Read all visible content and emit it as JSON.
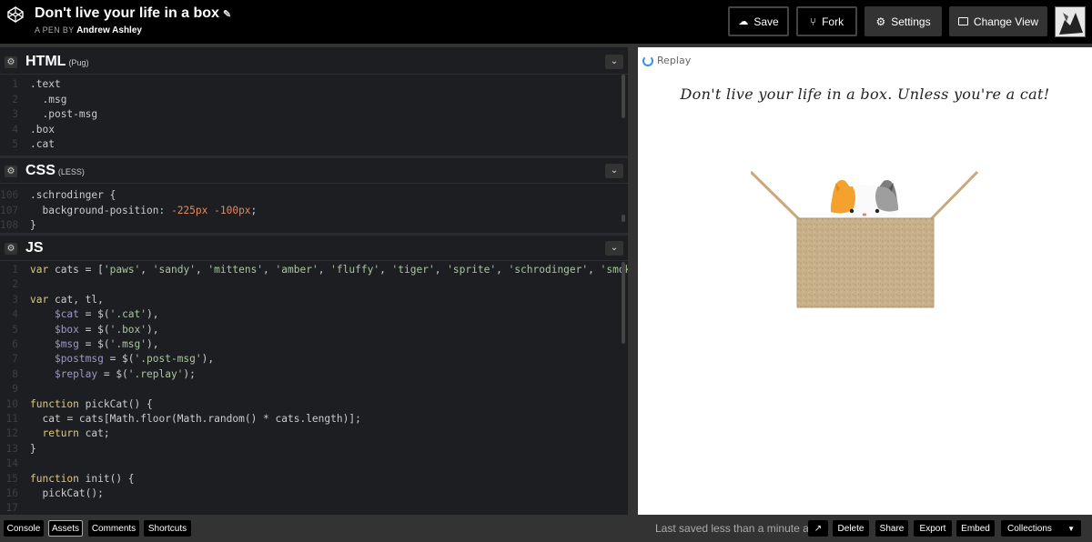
{
  "header": {
    "title": "Don't live your life in a box",
    "byline_prefix": "A PEN BY",
    "author": "Andrew Ashley",
    "buttons": {
      "save": "Save",
      "fork": "Fork",
      "settings": "Settings",
      "change_view": "Change View"
    }
  },
  "editors": {
    "html": {
      "label": "HTML",
      "sub": "(Pug)",
      "lines": [
        {
          "num": "1",
          "code": ".text"
        },
        {
          "num": "2",
          "code": "  .msg"
        },
        {
          "num": "3",
          "code": "  .post-msg"
        },
        {
          "num": "4",
          "code": ".box"
        },
        {
          "num": "5",
          "code": ".cat"
        }
      ]
    },
    "css": {
      "label": "CSS",
      "sub": "(LESS)",
      "lines": [
        {
          "num": "106",
          "code": ".schrodinger {"
        },
        {
          "num": "107",
          "code": "  background-position: -225px -100px;"
        },
        {
          "num": "108",
          "code": "}"
        }
      ]
    },
    "js": {
      "label": "JS",
      "lines": [
        {
          "num": "1",
          "code": "var cats = ['paws', 'sandy', 'mittens', 'amber', 'fluffy', 'tiger', 'sprite', 'schrodinger', 'smokey'];"
        },
        {
          "num": "2",
          "code": ""
        },
        {
          "num": "3",
          "code": "var cat, tl,"
        },
        {
          "num": "4",
          "code": "    $cat = $('.cat'),"
        },
        {
          "num": "5",
          "code": "    $box = $('.box'),"
        },
        {
          "num": "6",
          "code": "    $msg = $('.msg'),"
        },
        {
          "num": "7",
          "code": "    $postmsg = $('.post-msg'),"
        },
        {
          "num": "8",
          "code": "    $replay = $('.replay');"
        },
        {
          "num": "9",
          "code": ""
        },
        {
          "num": "10",
          "code": "function pickCat() {"
        },
        {
          "num": "11",
          "code": "  cat = cats[Math.floor(Math.random() * cats.length)];"
        },
        {
          "num": "12",
          "code": "  return cat;"
        },
        {
          "num": "13",
          "code": "}"
        },
        {
          "num": "14",
          "code": ""
        },
        {
          "num": "15",
          "code": "function init() {"
        },
        {
          "num": "16",
          "code": "  pickCat();"
        },
        {
          "num": "17",
          "code": ""
        }
      ]
    }
  },
  "preview": {
    "replay_label": "Replay",
    "message": "Don't live your life in a box. Unless you're a cat!"
  },
  "footer": {
    "left_buttons": [
      "Console",
      "Assets",
      "Comments",
      "Shortcuts"
    ],
    "saved_text": "Last saved less than a minute ago",
    "right_buttons": [
      "Delete",
      "Share",
      "Export",
      "Embed"
    ],
    "collections": "Collections"
  }
}
